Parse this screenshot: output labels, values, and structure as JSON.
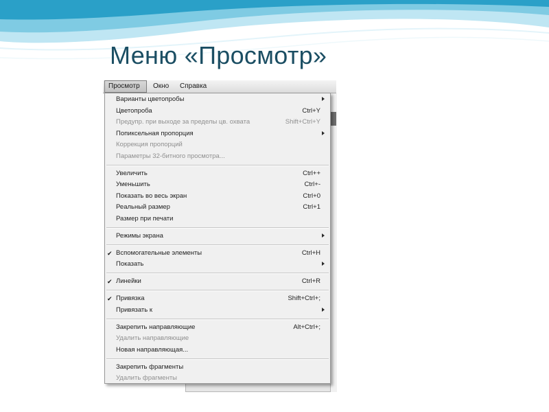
{
  "slide": {
    "title": "Меню «Просмотр»"
  },
  "menubar": [
    {
      "label": "Просмотр",
      "active": true
    },
    {
      "label": "Окно",
      "active": false
    },
    {
      "label": "Справка",
      "active": false
    }
  ],
  "menu_groups": [
    [
      {
        "label": "Варианты цветопробы",
        "shortcut": "",
        "submenu": true,
        "checked": false,
        "disabled": false
      },
      {
        "label": "Цветопроба",
        "shortcut": "Ctrl+Y",
        "submenu": false,
        "checked": false,
        "disabled": false
      },
      {
        "label": "Предупр. при выходе за пределы цв. охвата",
        "shortcut": "Shift+Ctrl+Y",
        "submenu": false,
        "checked": false,
        "disabled": true
      },
      {
        "label": "Попиксельная пропорция",
        "shortcut": "",
        "submenu": true,
        "checked": false,
        "disabled": false
      },
      {
        "label": "Коррекция пропорций",
        "shortcut": "",
        "submenu": false,
        "checked": false,
        "disabled": true
      },
      {
        "label": "Параметры 32-битного просмотра...",
        "shortcut": "",
        "submenu": false,
        "checked": false,
        "disabled": true
      }
    ],
    [
      {
        "label": "Увеличить",
        "shortcut": "Ctrl++",
        "submenu": false,
        "checked": false,
        "disabled": false
      },
      {
        "label": "Уменьшить",
        "shortcut": "Ctrl+-",
        "submenu": false,
        "checked": false,
        "disabled": false
      },
      {
        "label": "Показать во весь экран",
        "shortcut": "Ctrl+0",
        "submenu": false,
        "checked": false,
        "disabled": false
      },
      {
        "label": "Реальный размер",
        "shortcut": "Ctrl+1",
        "submenu": false,
        "checked": false,
        "disabled": false
      },
      {
        "label": "Размер при печати",
        "shortcut": "",
        "submenu": false,
        "checked": false,
        "disabled": false
      }
    ],
    [
      {
        "label": "Режимы экрана",
        "shortcut": "",
        "submenu": true,
        "checked": false,
        "disabled": false
      }
    ],
    [
      {
        "label": "Вспомогательные элементы",
        "shortcut": "Ctrl+H",
        "submenu": false,
        "checked": true,
        "disabled": false
      },
      {
        "label": "Показать",
        "shortcut": "",
        "submenu": true,
        "checked": false,
        "disabled": false
      }
    ],
    [
      {
        "label": "Линейки",
        "shortcut": "Ctrl+R",
        "submenu": false,
        "checked": true,
        "disabled": false
      }
    ],
    [
      {
        "label": "Привязка",
        "shortcut": "Shift+Ctrl+;",
        "submenu": false,
        "checked": true,
        "disabled": false
      },
      {
        "label": "Привязать к",
        "shortcut": "",
        "submenu": true,
        "checked": false,
        "disabled": false
      }
    ],
    [
      {
        "label": "Закрепить направляющие",
        "shortcut": "Alt+Ctrl+;",
        "submenu": false,
        "checked": false,
        "disabled": false
      },
      {
        "label": "Удалить направляющие",
        "shortcut": "",
        "submenu": false,
        "checked": false,
        "disabled": true
      },
      {
        "label": "Новая направляющая...",
        "shortcut": "",
        "submenu": false,
        "checked": false,
        "disabled": false
      }
    ],
    [
      {
        "label": "Закрепить фрагменты",
        "shortcut": "",
        "submenu": false,
        "checked": false,
        "disabled": false
      },
      {
        "label": "Удалить фрагменты",
        "shortcut": "",
        "submenu": false,
        "checked": false,
        "disabled": true
      }
    ]
  ],
  "icons": {
    "check": "check-icon",
    "submenu": "submenu-arrow-icon"
  },
  "colors": {
    "title": "#1b4e63",
    "wave_dark": "#2aa0c8",
    "wave_light": "#bfe6f3",
    "disabled_text": "#8f8f8f"
  }
}
